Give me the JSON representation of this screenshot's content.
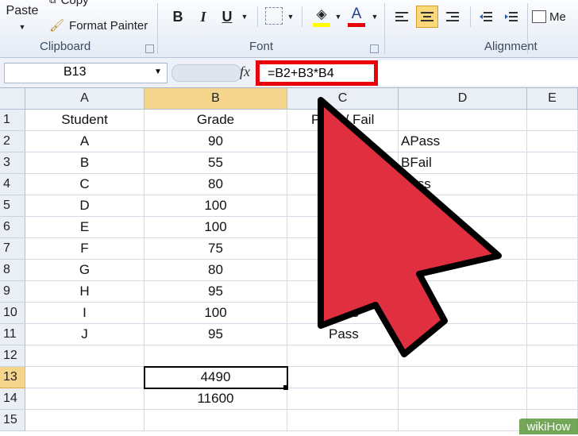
{
  "ribbon": {
    "paste_label": "Paste",
    "copy_label": "Copy",
    "format_painter_label": "Format Painter",
    "clipboard_group": "Clipboard",
    "font_group": "Font",
    "alignment_group": "Alignment",
    "bold_label": "B",
    "italic_label": "I",
    "underline_label": "U",
    "font_color_label": "A",
    "merge_label": "Me"
  },
  "formula_bar": {
    "name_box": "B13",
    "fx_label": "fx",
    "formula": "=B2+B3*B4"
  },
  "columns": [
    "A",
    "B",
    "C",
    "D",
    "E"
  ],
  "rows": [
    {
      "n": "1",
      "a": "Student",
      "b": "Grade",
      "c": "Pass / Fail",
      "d": ""
    },
    {
      "n": "2",
      "a": "A",
      "b": "90",
      "c": "",
      "d": "APass"
    },
    {
      "n": "3",
      "a": "B",
      "b": "55",
      "c": "",
      "d": "BFail"
    },
    {
      "n": "4",
      "a": "C",
      "b": "80",
      "c": "",
      "d": "Pass"
    },
    {
      "n": "5",
      "a": "D",
      "b": "100",
      "c": "",
      "d": ""
    },
    {
      "n": "6",
      "a": "E",
      "b": "100",
      "c": "",
      "d": ""
    },
    {
      "n": "7",
      "a": "F",
      "b": "75",
      "c": "",
      "d": ""
    },
    {
      "n": "8",
      "a": "G",
      "b": "80",
      "c": "",
      "d": "Pass"
    },
    {
      "n": "9",
      "a": "H",
      "b": "95",
      "c": "",
      "d": "Pass"
    },
    {
      "n": "10",
      "a": "I",
      "b": "100",
      "c": "Pass",
      "d": ""
    },
    {
      "n": "11",
      "a": "J",
      "b": "95",
      "c": "Pass",
      "d": "1"
    },
    {
      "n": "12",
      "a": "",
      "b": "",
      "c": "",
      "d": ""
    },
    {
      "n": "13",
      "a": "",
      "b": "4490",
      "c": "",
      "d": ""
    },
    {
      "n": "14",
      "a": "",
      "b": "11600",
      "c": "",
      "d": ""
    },
    {
      "n": "15",
      "a": "",
      "b": "",
      "c": "",
      "d": ""
    }
  ],
  "watermark": "wikiHow",
  "colors": {
    "highlight_red": "#e8000b",
    "arrow_red": "#e03040",
    "selected_header": "#f5d48c"
  }
}
